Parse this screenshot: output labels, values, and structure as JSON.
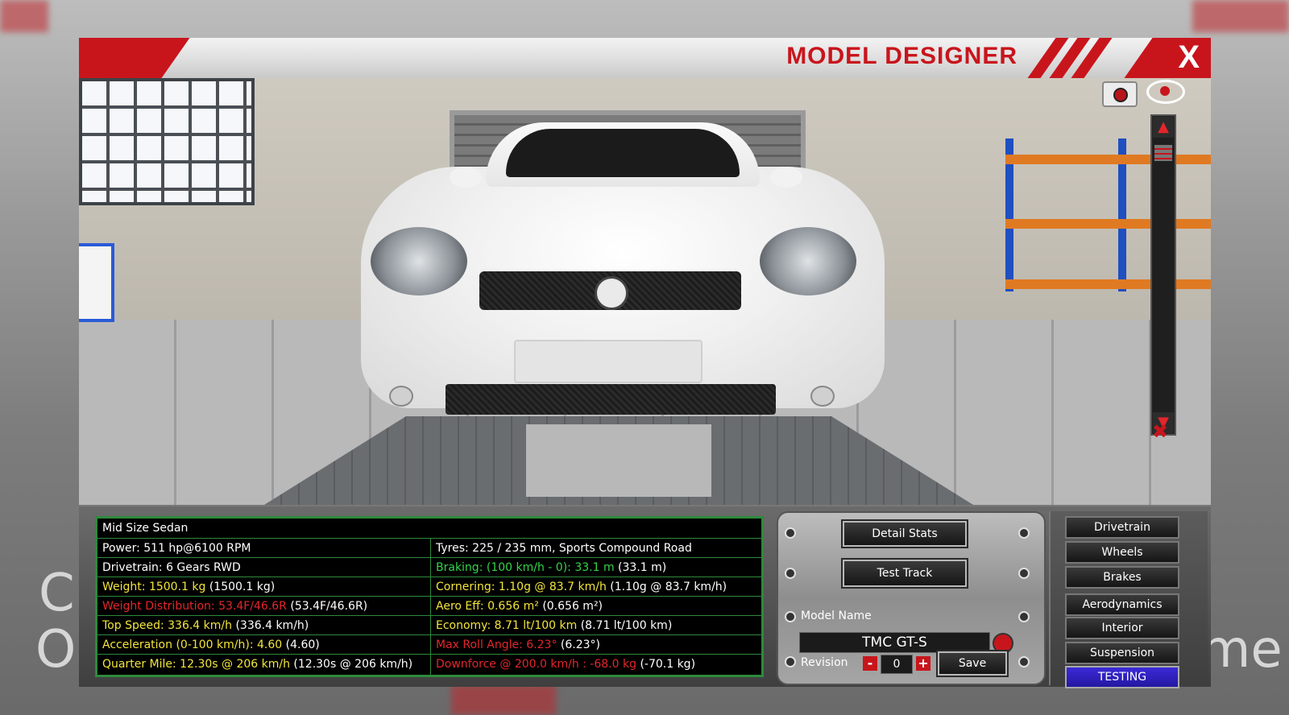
{
  "backdrop": {
    "letters_left": [
      "C",
      "O"
    ],
    "letters_right": [
      "me"
    ]
  },
  "window": {
    "title": "MODEL DESIGNER",
    "close_label": "X"
  },
  "viewport": {
    "icons": [
      "camera-icon",
      "eye-icon",
      "scroll-up-icon",
      "scroll-down-icon",
      "hide-eye-icon"
    ],
    "scroll_up": "▲",
    "scroll_down": "▼",
    "hide_icon": "✖"
  },
  "stats": {
    "body_type": "Mid Size Sedan",
    "left": [
      {
        "label": "Power: 511 hp@6100 RPM",
        "extra": "",
        "color": "w"
      },
      {
        "label": "Drivetrain: 6 Gears RWD",
        "extra": "",
        "color": "w"
      },
      {
        "label": "Weight: 1500.1 kg",
        "extra": "(1500.1 kg)",
        "color": "y"
      },
      {
        "label": "Weight Distribution: 53.4F/46.6R",
        "extra": "(53.4F/46.6R)",
        "color": "r"
      },
      {
        "label": "Top Speed: 336.4 km/h",
        "extra": "(336.4 km/h)",
        "color": "y"
      },
      {
        "label": "Acceleration (0-100 km/h): 4.60",
        "extra": "(4.60)",
        "color": "y"
      },
      {
        "label": "Quarter Mile: 12.30s @ 206 km/h",
        "extra": "(12.30s @ 206 km/h)",
        "color": "y"
      }
    ],
    "right": [
      {
        "label": "Tyres: 225 / 235 mm, Sports Compound Road",
        "extra": "",
        "color": "w"
      },
      {
        "label": "Braking: (100 km/h - 0): 33.1 m",
        "extra": "(33.1 m)",
        "color": "g"
      },
      {
        "label": "Cornering: 1.10g @ 83.7 km/h",
        "extra": "(1.10g @ 83.7 km/h)",
        "color": "y"
      },
      {
        "label": "Aero Eff: 0.656 m²",
        "extra": "(0.656 m²)",
        "color": "y"
      },
      {
        "label": "Economy: 8.71 lt/100 km",
        "extra": "(8.71 lt/100 km)",
        "color": "y"
      },
      {
        "label": "Max Roll Angle: 6.23°",
        "extra": "(6.23°)",
        "color": "r"
      },
      {
        "label": "Downforce @ 200.0 km/h : -68.0 kg",
        "extra": "(-70.1 kg)",
        "color": "r"
      }
    ]
  },
  "controls": {
    "detail_stats": "Detail Stats",
    "test_track": "Test Track",
    "model_name_label": "Model Name",
    "model_name_value": "TMC GT-S",
    "revision_label": "Revision",
    "revision_minus": "-",
    "revision_value": "0",
    "revision_plus": "+",
    "save": "Save"
  },
  "nav": {
    "items": [
      "Drivetrain",
      "Wheels",
      "Brakes",
      "Aerodynamics",
      "Interior",
      "Suspension",
      "TESTING"
    ],
    "active_index": 6
  },
  "colors": {
    "accent_red": "#c8151c",
    "stat_green": "#34d34a",
    "stat_yellow": "#f2e53b",
    "active_blue": "#2418a0"
  }
}
